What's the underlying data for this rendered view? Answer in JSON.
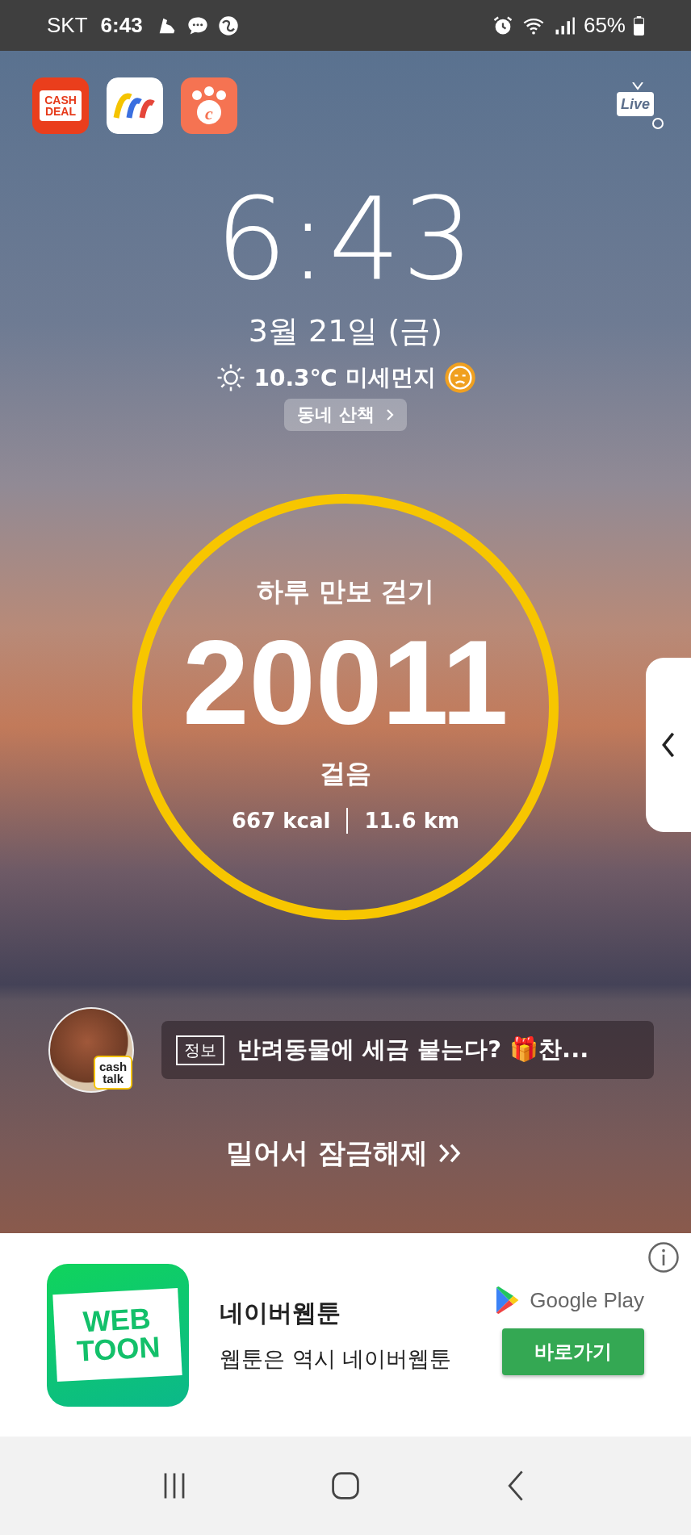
{
  "status_bar": {
    "carrier": "SKT",
    "time": "6:43",
    "battery": "65%"
  },
  "shortcuts": [
    {
      "kind": "cashdeal",
      "label_lines": [
        "CASH",
        "DEAL"
      ]
    },
    {
      "kind": "arches"
    },
    {
      "kind": "paw",
      "label": "c"
    }
  ],
  "live_badge": {
    "label": "Live"
  },
  "clock": {
    "time": "6:43",
    "date": "3월 21일 (금)",
    "temperature": "10.3℃",
    "dust_label": "미세먼지",
    "walk_chip": "동네 산책"
  },
  "steps": {
    "title": "하루 만보 걷기",
    "count": "20011",
    "unit": "걸음",
    "calories": "667 kcal",
    "distance": "11.6 km",
    "level": 1
  },
  "news": {
    "badge_lines": [
      "cash",
      "talk"
    ],
    "tag": "정보",
    "headline": "반려동물에 세금 붙는다? 🎁찬..."
  },
  "unlock": {
    "label": "밀어서 잠금해제"
  },
  "ad": {
    "icon_lines": [
      "WEB",
      "TOON"
    ],
    "title": "네이버웹툰",
    "tagline": "웹툰은 역시 네이버웹툰",
    "store": "Google Play",
    "button": "바로가기"
  }
}
